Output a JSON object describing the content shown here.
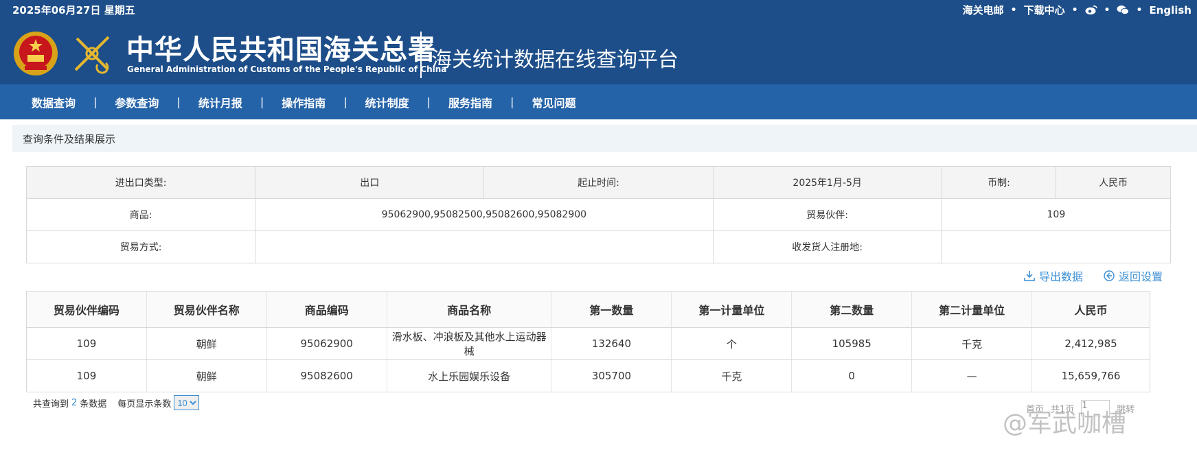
{
  "topbar": {
    "date": "2025年06月27日 星期五",
    "links": [
      "海关电邮",
      "下载中心"
    ],
    "social_icons": [
      "weibo-icon",
      "wechat-icon"
    ],
    "language": "English"
  },
  "header": {
    "org_name_cn": "中华人民共和国海关总署",
    "org_name_en": "General Administration of Customs of the People's Republic of China",
    "platform_title": "海关统计数据在线查询平台",
    "colors": {
      "header_bg": "#1d4e89",
      "nav_bg": "#2563a8",
      "accent": "#3a8ed4"
    }
  },
  "nav": {
    "items": [
      "数据查询",
      "参数查询",
      "统计月报",
      "操作指南",
      "统计制度",
      "服务指南",
      "常见问题"
    ]
  },
  "breadcrumb": "查询条件及结果展示",
  "query": {
    "trade_type_label": "进出口类型:",
    "trade_type_value": "出口",
    "period_label": "起止时间:",
    "period_value": "2025年1月-5月",
    "currency_label": "币制:",
    "currency_value": "人民币",
    "commodity_label": "商品:",
    "commodity_value": "95062900,95082500,95082600,95082900",
    "partner_label": "贸易伙伴:",
    "partner_value": "109",
    "mode_label": "贸易方式:",
    "mode_value": "",
    "registry_label": "收发货人注册地:",
    "registry_value": ""
  },
  "actions": {
    "export": "导出数据",
    "back": "返回设置"
  },
  "results": {
    "headers": [
      "贸易伙伴编码",
      "贸易伙伴名称",
      "商品编码",
      "商品名称",
      "第一数量",
      "第一计量单位",
      "第二数量",
      "第二计量单位",
      "人民币"
    ],
    "rows": [
      [
        "109",
        "朝鲜",
        "95062900",
        "滑水板、冲浪板及其他水上运动器械",
        "132640",
        "个",
        "105985",
        "千克",
        "2,412,985"
      ],
      [
        "109",
        "朝鲜",
        "95082600",
        "水上乐园娱乐设备",
        "305700",
        "千克",
        "0",
        "—",
        "15,659,766"
      ]
    ]
  },
  "summary": {
    "prefix": "共查询到",
    "count": "2",
    "suffix": "条数据",
    "per_page_label": "每页显示条数",
    "per_page_value": "10"
  },
  "pager": {
    "first": "首页",
    "total": "共1页",
    "page": "1",
    "jump": "跳转"
  },
  "watermark": "@军武咖槽"
}
